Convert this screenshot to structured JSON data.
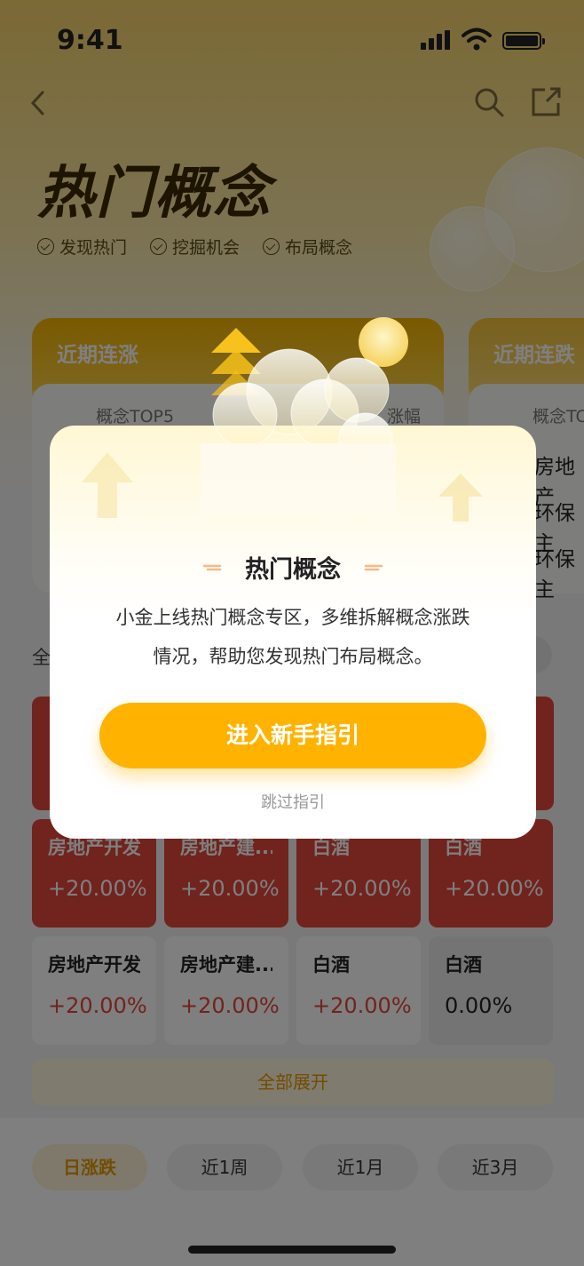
{
  "status_bar": {
    "time": "9:41"
  },
  "header": {
    "title": "热门概念",
    "tags": [
      "发现热门",
      "挖掘机会",
      "布局概念"
    ]
  },
  "cards": {
    "rising": {
      "title": "近期连涨",
      "col_left": "概念TOP5",
      "col_right": "涨幅"
    },
    "falling": {
      "title": "近期连跌",
      "col_left": "概念TC",
      "items": [
        "房地产",
        "环保主",
        "环保主"
      ]
    }
  },
  "filter": {
    "all_label": "全"
  },
  "grid": {
    "row1": [
      {
        "name": "房地产开发",
        "value": "+20.00%"
      },
      {
        "name": "房地产建...",
        "value": "+20.00%"
      },
      {
        "name": "白酒",
        "value": "+20.00%"
      },
      {
        "name": "白酒",
        "value": "+20.00%"
      }
    ],
    "row2": [
      {
        "name": "房地产开发",
        "value": "+20.00%"
      },
      {
        "name": "房地产建...",
        "value": "+20.00%"
      },
      {
        "name": "白酒",
        "value": "+20.00%"
      },
      {
        "name": "白酒",
        "value": "0.00%"
      }
    ],
    "expand_label": "全部展开"
  },
  "periods": [
    "日涨跌",
    "近1周",
    "近1月",
    "近3月"
  ],
  "modal": {
    "title": "热门概念",
    "body_line1": "小金上线热门概念专区，多维拆解概念涨跌",
    "body_line2": "情况，帮助您发现热门布局概念。",
    "cta_label": "进入新手指引",
    "skip_label": "跳过指引"
  },
  "colors": {
    "accent": "#ffb300",
    "up_red": "#e2463b",
    "brand_text": "#3b2a00"
  }
}
